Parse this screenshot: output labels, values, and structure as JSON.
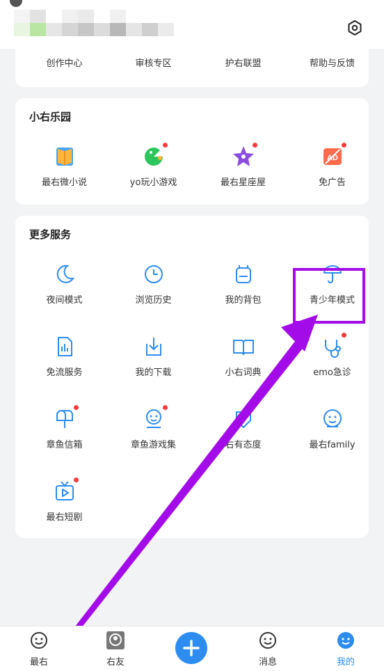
{
  "top_row": {
    "items": [
      {
        "label": "创作中心",
        "icon": "create-center-icon"
      },
      {
        "label": "审核专区",
        "icon": "review-zone-icon"
      },
      {
        "label": "护右联盟",
        "icon": "alliance-icon"
      },
      {
        "label": "帮助与反馈",
        "icon": "help-feedback-icon"
      }
    ]
  },
  "playground": {
    "title": "小右乐园",
    "items": [
      {
        "label": "最右微小说",
        "icon": "book-icon",
        "badge": false
      },
      {
        "label": "yo玩小游戏",
        "icon": "game-icon",
        "badge": true
      },
      {
        "label": "最右星座屋",
        "icon": "star-icon",
        "badge": true
      },
      {
        "label": "免广告",
        "icon": "ad-free-icon",
        "badge": true
      }
    ]
  },
  "more_services": {
    "title": "更多服务",
    "items": [
      {
        "label": "夜间模式",
        "icon": "moon-icon",
        "badge": false
      },
      {
        "label": "浏览历史",
        "icon": "clock-icon",
        "badge": false
      },
      {
        "label": "我的背包",
        "icon": "backpack-icon",
        "badge": false
      },
      {
        "label": "青少年模式",
        "icon": "umbrella-icon",
        "badge": false
      },
      {
        "label": "免流服务",
        "icon": "data-free-icon",
        "badge": false
      },
      {
        "label": "我的下载",
        "icon": "download-icon",
        "badge": false
      },
      {
        "label": "小右词典",
        "icon": "dictionary-icon",
        "badge": false
      },
      {
        "label": "emo急诊",
        "icon": "stethoscope-icon",
        "badge": true
      },
      {
        "label": "章鱼信箱",
        "icon": "mailbox-icon",
        "badge": true
      },
      {
        "label": "章鱼游戏集",
        "icon": "game-collection-icon",
        "badge": true
      },
      {
        "label": "右有态度",
        "icon": "attitude-icon",
        "badge": false
      },
      {
        "label": "最右family",
        "icon": "family-icon",
        "badge": false
      },
      {
        "label": "最右短剧",
        "icon": "tv-icon",
        "badge": true
      }
    ]
  },
  "bottom_nav": {
    "tabs": [
      {
        "label": "最右",
        "icon": "home-face-icon"
      },
      {
        "label": "右友",
        "icon": "friends-icon"
      },
      {
        "label": "",
        "icon": "plus-icon"
      },
      {
        "label": "消息",
        "icon": "message-icon"
      },
      {
        "label": "我的",
        "icon": "profile-icon"
      }
    ]
  },
  "colors": {
    "accent": "#2d8cf0",
    "highlight": "#a30ce8",
    "badge": "#ff3b3b",
    "background": "#f2f3f5"
  }
}
